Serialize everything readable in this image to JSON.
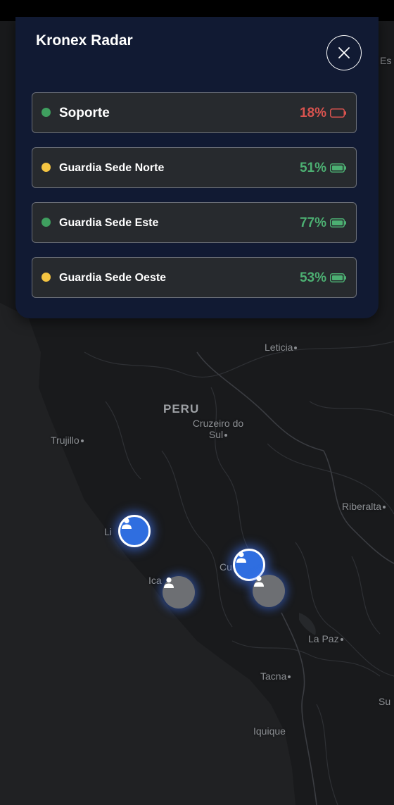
{
  "app": {
    "title": "Kronex Radar"
  },
  "colors": {
    "status_online": "#3f9f5f",
    "status_warning": "#f5c542",
    "battery_low": "#d9534f",
    "battery_ok": "#4caf72",
    "marker_active": "#2f6ee0",
    "marker_idle": "#6d6f73"
  },
  "devices": [
    {
      "name": "Soporte",
      "status": "online",
      "battery_pct": "18%",
      "battery_level": 0.18,
      "battery_state": "low"
    },
    {
      "name": "Guardia Sede Norte",
      "status": "warning",
      "battery_pct": "51%",
      "battery_level": 0.51,
      "battery_state": "ok"
    },
    {
      "name": "Guardia Sede Este",
      "status": "online",
      "battery_pct": "77%",
      "battery_level": 0.77,
      "battery_state": "ok"
    },
    {
      "name": "Guardia Sede Oeste",
      "status": "warning",
      "battery_pct": "53%",
      "battery_level": 0.53,
      "battery_state": "ok"
    }
  ],
  "map": {
    "country_label": "PERU",
    "places": [
      "Leticia",
      "Cruzeiro do Sul",
      "Trujillo",
      "Riberalta",
      "Li",
      "Ica",
      "Cu",
      "La Paz",
      "Tacna",
      "Iquique",
      "Su",
      "Es"
    ],
    "markers": [
      {
        "icon": "person-icon",
        "state": "active"
      },
      {
        "icon": "person-icon",
        "state": "idle"
      },
      {
        "icon": "person-icon",
        "state": "active"
      },
      {
        "icon": "person-icon",
        "state": "idle"
      }
    ]
  }
}
